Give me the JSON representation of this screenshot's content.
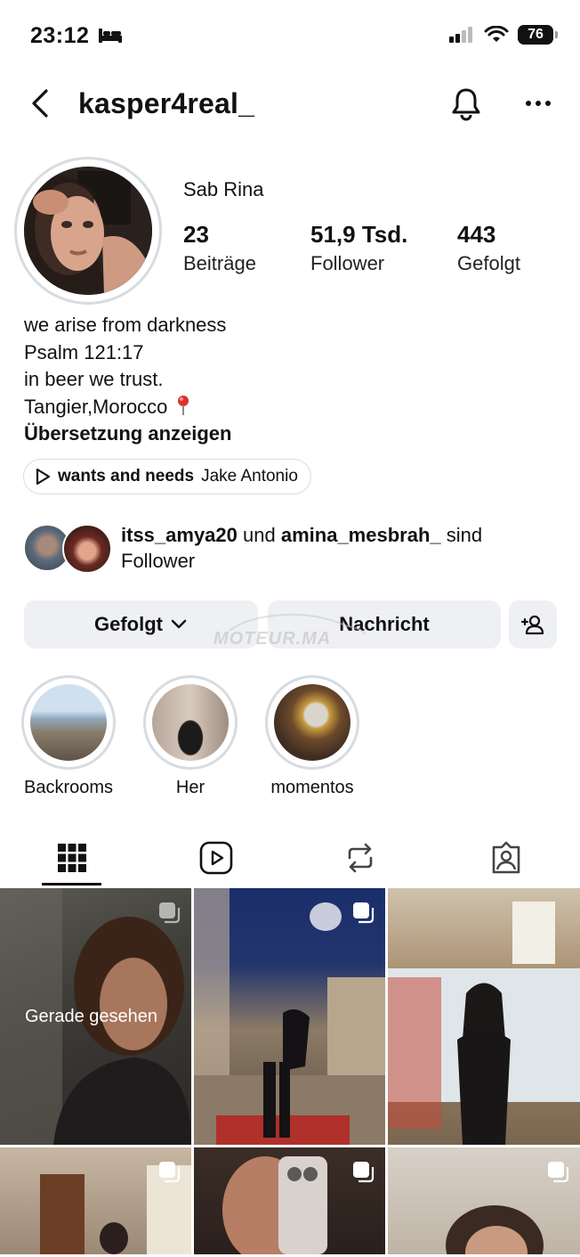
{
  "status": {
    "time": "23:12",
    "battery": "76"
  },
  "nav": {
    "username": "kasper4real_"
  },
  "profile": {
    "name": "Sab Rina",
    "stats": [
      {
        "value": "23",
        "label": "Beiträge"
      },
      {
        "value": "51,9 Tsd.",
        "label": "Follower"
      },
      {
        "value": "443",
        "label": "Gefolgt"
      }
    ],
    "bio": [
      "we arise from darkness",
      "Psalm 121:17",
      "in beer we trust.",
      "Tangier,Morocco"
    ],
    "translate": "Übersetzung anzeigen",
    "music": {
      "song": "wants and needs",
      "artist": "Jake Antonio"
    }
  },
  "mutual": {
    "user1": "itss_amya20",
    "conj": "und",
    "user2": "amina_mesbrah_",
    "suffix": "sind",
    "line2": "Follower"
  },
  "actions": {
    "following": "Gefolgt",
    "message": "Nachricht"
  },
  "watermark": "MOTEUR.MA",
  "highlights": [
    {
      "label": "Backrooms"
    },
    {
      "label": "Her"
    },
    {
      "label": "momentos"
    }
  ],
  "grid": {
    "seen_label": "Gerade gesehen"
  }
}
